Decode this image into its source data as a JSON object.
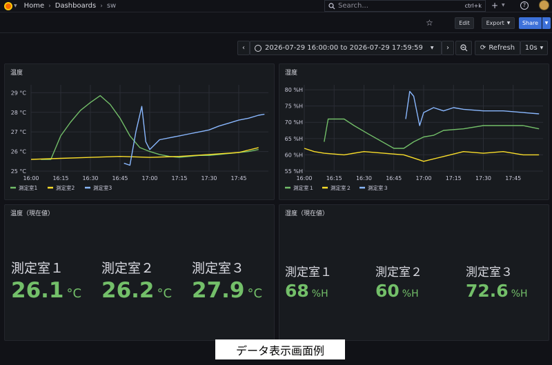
{
  "nav": {
    "breadcrumb": [
      "Home",
      "Dashboards",
      "sw"
    ],
    "search_placeholder": "Search...",
    "search_shortcut": "ctrl+k"
  },
  "toolbar": {
    "edit_label": "Edit",
    "export_label": "Export",
    "share_label": "Share"
  },
  "timebar": {
    "range": "2026-07-29 16:00:00 to 2026-07-29 17:59:59",
    "refresh_label": "Refresh",
    "interval": "10s"
  },
  "panels": {
    "temp_chart_title": "温度",
    "humid_chart_title": "湿度",
    "temp_stat_title": "温度（現在値）",
    "humid_stat_title": "湿度（現在値）"
  },
  "stats": {
    "temp": [
      {
        "name": "測定室１",
        "value": "26.1",
        "unit": "°C"
      },
      {
        "name": "測定室２",
        "value": "26.2",
        "unit": "°C"
      },
      {
        "name": "測定室３",
        "value": "27.9",
        "unit": "°C"
      }
    ],
    "humid": [
      {
        "name": "測定室１",
        "value": "68",
        "unit": "%H"
      },
      {
        "name": "測定室２",
        "value": "60",
        "unit": "%H"
      },
      {
        "name": "測定室３",
        "value": "72.6",
        "unit": "%H"
      }
    ]
  },
  "caption": "データ表示画面例",
  "colors": {
    "series1": "#73bf69",
    "series2": "#fade2a",
    "series3": "#8ab8ff",
    "stat_value": "#73bf69"
  },
  "chart_data": [
    {
      "type": "line",
      "title": "温度",
      "x_ticks": [
        "16:00",
        "16:15",
        "16:30",
        "16:45",
        "17:00",
        "17:15",
        "17:30",
        "17:45"
      ],
      "y_ticks": [
        "25 °C",
        "26 °C",
        "27 °C",
        "28 °C",
        "29 °C"
      ],
      "ylim": [
        25,
        29.4
      ],
      "xlim": [
        "16:00",
        "18:00"
      ],
      "legend": "bottom-left",
      "series": [
        {
          "name": "測定室1",
          "color": "#73bf69",
          "x": [
            "16:05",
            "16:10",
            "16:15",
            "16:20",
            "16:25",
            "16:30",
            "16:35",
            "16:40",
            "16:45",
            "16:50",
            "16:55",
            "17:00",
            "17:05",
            "17:10",
            "17:15",
            "17:20",
            "17:25",
            "17:30",
            "17:35",
            "17:40",
            "17:45",
            "17:50",
            "17:55"
          ],
          "y": [
            25.6,
            25.6,
            26.8,
            27.5,
            28.1,
            28.5,
            28.85,
            28.4,
            27.7,
            26.8,
            26.2,
            26.0,
            25.85,
            25.75,
            25.7,
            25.75,
            25.8,
            25.8,
            25.85,
            25.9,
            25.95,
            26.0,
            26.1
          ]
        },
        {
          "name": "測定室2",
          "color": "#fade2a",
          "x": [
            "16:00",
            "16:15",
            "16:30",
            "16:45",
            "17:00",
            "17:15",
            "17:30",
            "17:45",
            "17:55"
          ],
          "y": [
            25.6,
            25.65,
            25.7,
            25.75,
            25.7,
            25.75,
            25.85,
            25.95,
            26.2
          ]
        },
        {
          "name": "測定室3",
          "color": "#8ab8ff",
          "x": [
            "16:47",
            "16:50",
            "16:53",
            "16:56",
            "16:58",
            "17:00",
            "17:02",
            "17:05",
            "17:10",
            "17:15",
            "17:20",
            "17:25",
            "17:30",
            "17:35",
            "17:40",
            "17:45",
            "17:50",
            "17:55",
            "17:58"
          ],
          "y": [
            25.4,
            25.3,
            27.0,
            28.3,
            26.5,
            26.1,
            26.3,
            26.6,
            26.7,
            26.8,
            26.9,
            27.0,
            27.1,
            27.3,
            27.45,
            27.6,
            27.7,
            27.85,
            27.9
          ]
        }
      ]
    },
    {
      "type": "line",
      "title": "湿度",
      "x_ticks": [
        "16:00",
        "16:15",
        "16:30",
        "16:45",
        "17:00",
        "17:15",
        "17:30",
        "17:45"
      ],
      "y_ticks": [
        "55 %H",
        "60 %H",
        "65 %H",
        "70 %H",
        "75 %H",
        "80 %H"
      ],
      "ylim": [
        55,
        81.5
      ],
      "xlim": [
        "16:00",
        "18:00"
      ],
      "legend": "bottom-left",
      "series": [
        {
          "name": "測定室１",
          "color": "#73bf69",
          "x": [
            "16:10",
            "16:12",
            "16:20",
            "16:25",
            "16:32",
            "16:45",
            "16:50",
            "16:55",
            "17:00",
            "17:05",
            "17:10",
            "17:20",
            "17:30",
            "17:40",
            "17:50",
            "17:58"
          ],
          "y": [
            64,
            71,
            71,
            69,
            66.5,
            62,
            62,
            64,
            65.5,
            66,
            67.5,
            68,
            69,
            69,
            69,
            68
          ]
        },
        {
          "name": "測定室２",
          "color": "#fade2a",
          "x": [
            "16:00",
            "16:05",
            "16:10",
            "16:20",
            "16:30",
            "16:40",
            "16:50",
            "16:55",
            "17:00",
            "17:10",
            "17:20",
            "17:30",
            "17:40",
            "17:50",
            "17:58"
          ],
          "y": [
            62,
            61,
            60.5,
            60,
            61,
            60.5,
            60,
            59,
            58,
            59.5,
            61,
            60.5,
            61,
            60,
            60
          ]
        },
        {
          "name": "測定室３",
          "color": "#8ab8ff",
          "x": [
            "16:51",
            "16:53",
            "16:55",
            "16:58",
            "17:00",
            "17:05",
            "17:10",
            "17:15",
            "17:20",
            "17:30",
            "17:40",
            "17:50",
            "17:58"
          ],
          "y": [
            71,
            79.5,
            78,
            69,
            73,
            74.5,
            73.5,
            74.5,
            74,
            73.5,
            73.5,
            73,
            72.6
          ]
        }
      ]
    }
  ]
}
